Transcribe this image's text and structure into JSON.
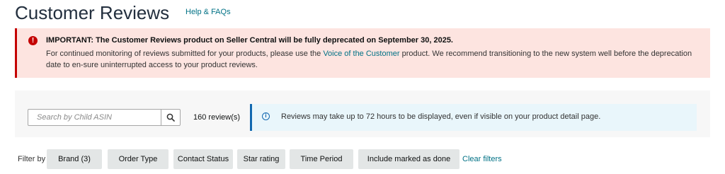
{
  "header": {
    "title": "Customer Reviews",
    "help_link": "Help & FAQs"
  },
  "alert": {
    "icon": "exclamation-circle-icon",
    "heading": "IMPORTANT: The Customer Reviews product on Seller Central will be fully deprecated on September 30, 2025.",
    "body_before_link": "For continued monitoring of reviews submitted for your products, please use the ",
    "link_text": "Voice of the Customer",
    "body_after_link": " product. We recommend transitioning to the new system well before the deprecation date to en-sure uninterrupted access to your product reviews.",
    "accent_color": "#c40000",
    "background_color": "#fde4e0"
  },
  "search": {
    "placeholder": "Search by Child ASIN",
    "value": "",
    "button_icon": "search-icon"
  },
  "review_count": "160 review(s)",
  "info": {
    "icon": "info-icon",
    "text": "Reviews may take up to 72 hours to be displayed, even if visible on your product detail page.",
    "accent_color": "#1168b0"
  },
  "filters": {
    "label": "Filter by",
    "items": [
      {
        "label": "Brand (3)"
      },
      {
        "label": "Order Type"
      },
      {
        "label": "Contact Status"
      },
      {
        "label": "Star rating"
      },
      {
        "label": "Time Period"
      },
      {
        "label": "Include marked as done"
      }
    ],
    "clear_label": "Clear filters"
  }
}
